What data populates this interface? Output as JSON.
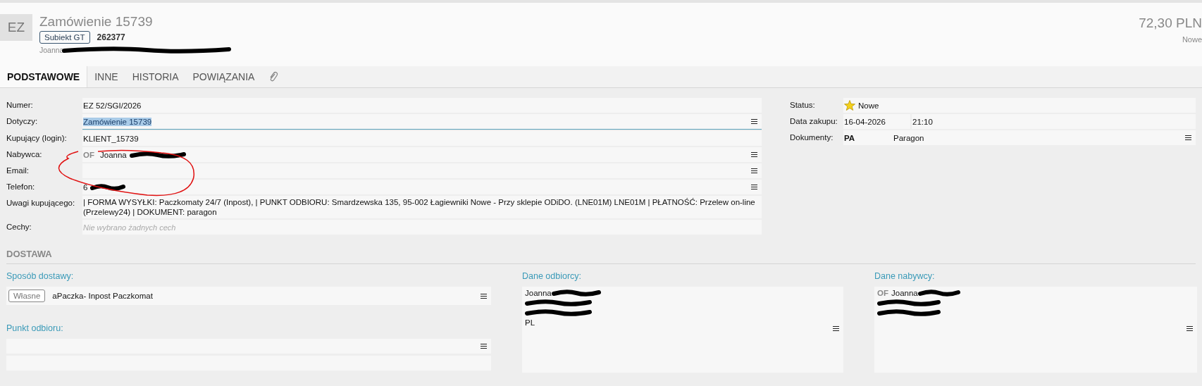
{
  "header": {
    "badge": "EZ",
    "title": "Zamówienie 15739",
    "source_tag": "Subiekt GT",
    "number": "262377",
    "address": {
      "text": "Joanna",
      "redacted": true
    },
    "amount": "72,30 PLN",
    "status": "Nowe"
  },
  "tabs": [
    {
      "kind": "text",
      "label": "PODSTAWOWE",
      "selected": true
    },
    {
      "kind": "text",
      "label": "INNE",
      "selected": false
    },
    {
      "kind": "text",
      "label": "HISTORIA",
      "selected": false
    },
    {
      "kind": "text",
      "label": "POWIĄZANIA",
      "selected": false
    },
    {
      "kind": "attachment",
      "selected": false
    }
  ],
  "fields": [
    {
      "label": "Numer:",
      "value": "EZ 52/SGI/2026"
    },
    {
      "label": "Dotyczy:",
      "value": "Zamówienie 15739",
      "highlighted": true,
      "menu": true
    },
    {
      "label": "Kupujący (login):",
      "value": "KLIENT_15739"
    },
    {
      "label": "Nabywca:",
      "prefix": "OF",
      "value": "Joanna",
      "redacted": true,
      "menu": true
    },
    {
      "label": "Email:",
      "menu": true
    },
    {
      "label": "Telefon:",
      "value": "6",
      "redacted": true,
      "menu": true
    },
    {
      "label": "Uwagi kupującego:",
      "value": "| FORMA WYSYŁKI: Paczkomaty 24/7 (Inpost),  | PUNKT ODBIORU: Smardzewska 135, 95-002 Łagiewniki Nowe - Przy sklepie ODiDO.  (LNE01M)  LNE01M  | PŁATNOŚĆ: Przelew on-line (Przelewy24) | DOKUMENT: paragon"
    },
    {
      "label": "Cechy:",
      "placeholder": "Nie wybrano żadnych cech"
    }
  ],
  "side_fields": [
    {
      "kind": "status",
      "label": "Status:",
      "value": "Nowe"
    },
    {
      "kind": "datetime",
      "label": "Data zakupu:",
      "date": "16-04-2026",
      "time": "21:10"
    },
    {
      "kind": "document",
      "label": "Dokumenty:",
      "code": "PA",
      "value": "Paragon",
      "menu": true
    }
  ],
  "delivery": {
    "title": "DOSTAWA",
    "method": {
      "label": "Sposób dostawy:",
      "tag": "Własne",
      "value": "aPaczka- Inpost Paczkomat",
      "menu": true
    },
    "pickup": {
      "label": "Punkt odbioru:",
      "menu": true
    },
    "recipient": {
      "label": "Dane odbiorcy:",
      "lines": [
        {
          "text": "Joanna",
          "redacted": true
        },
        {
          "redacted": true
        },
        {
          "redacted": true
        },
        {
          "text": "PL",
          "redacted": false
        }
      ],
      "menu": true
    },
    "buyer": {
      "label": "Dane nabywcy:",
      "prefix": "OF",
      "lines": [
        {
          "text": "Joanna",
          "redacted": true
        },
        {
          "redacted": true
        },
        {
          "redacted": true
        }
      ],
      "menu": true
    }
  }
}
